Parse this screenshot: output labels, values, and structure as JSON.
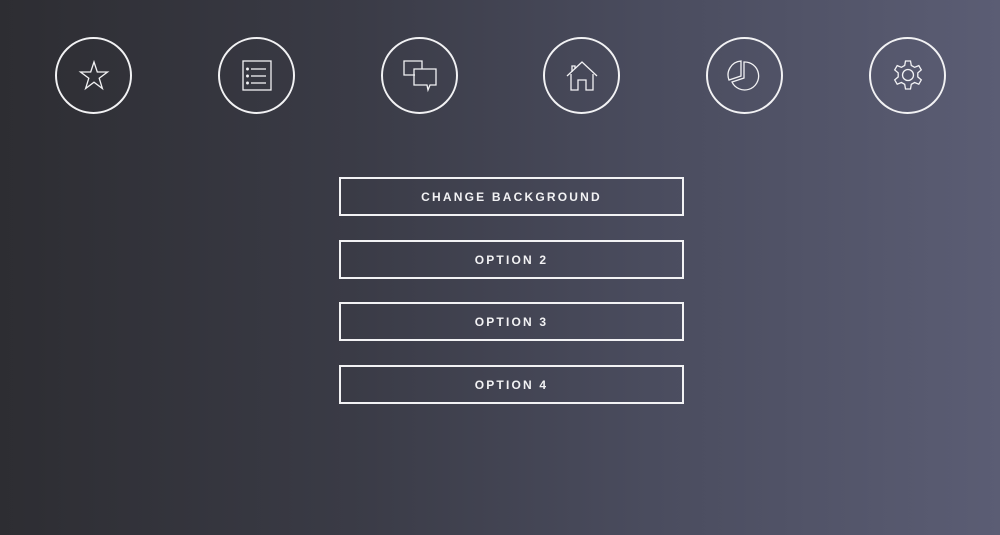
{
  "nav": {
    "icons": [
      "star-icon",
      "list-icon",
      "chat-icon",
      "home-icon",
      "pie-chart-icon",
      "gear-icon"
    ]
  },
  "menu": {
    "options": [
      {
        "label": "CHANGE BACKGROUND"
      },
      {
        "label": "OPTION 2"
      },
      {
        "label": "OPTION 3"
      },
      {
        "label": "OPTION 4"
      }
    ]
  },
  "colors": {
    "foreground": "#f2f2f4",
    "background_left": "#2d2d32",
    "background_right": "#5b5d74"
  }
}
